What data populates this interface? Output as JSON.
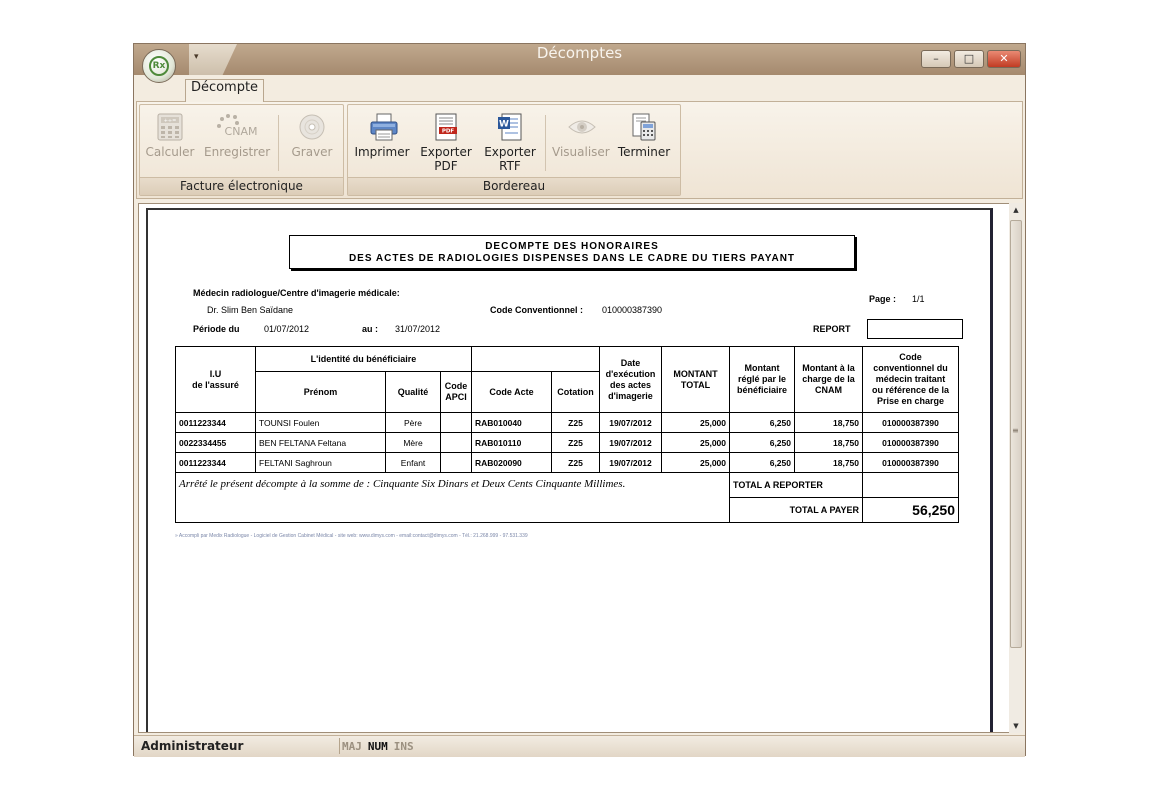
{
  "window": {
    "title": "Décomptes"
  },
  "app_button": {
    "label": "Rx"
  },
  "qat": {
    "arrow": "▾"
  },
  "controls": {
    "minimize": "–",
    "maximize": "□",
    "close": "✕"
  },
  "tabs": [
    {
      "label": "Décompte"
    }
  ],
  "ribbon": {
    "groups": [
      {
        "label": "Facture électronique"
      },
      {
        "label": "Bordereau"
      }
    ],
    "buttons": {
      "calculer": {
        "label": "Calculer",
        "icon": "calculator-icon",
        "icon_text": "+÷="
      },
      "enregistrer": {
        "label": "Enregistrer",
        "icon": "cnam-icon",
        "icon_text": "CNAM"
      },
      "graver": {
        "label": "Graver",
        "icon": "disc-icon"
      },
      "imprimer": {
        "label": "Imprimer",
        "icon": "printer-icon"
      },
      "exporter_pdf": {
        "line1": "Exporter",
        "line2": "PDF",
        "icon": "pdf-icon",
        "icon_text": "PDF"
      },
      "exporter_rtf": {
        "line1": "Exporter",
        "line2": "RTF",
        "icon": "word-icon",
        "icon_text": "W"
      },
      "visualiser": {
        "label": "Visualiser",
        "icon": "eye-icon"
      },
      "terminer": {
        "label": "Terminer",
        "icon": "calculator-document-icon"
      }
    }
  },
  "document": {
    "title_line1": "DECOMPTE DES HONORAIRES",
    "title_line2": "DES ACTES DE RADIOLOGIES DISPENSES DANS LE CADRE DU TIERS PAYANT",
    "medecin_label": "Médecin radiologue/Centre d'imagerie médicale:",
    "medecin_name": "Dr. Slim Ben Saïdane",
    "code_conv_label": "Code Conventionnel :",
    "code_conv_value": "010000387390",
    "page_label": "Page :",
    "page_value": "1/1",
    "periode_label": "Période du",
    "periode_from": "01/07/2012",
    "au_label": "au :",
    "periode_to": "31/07/2012",
    "report_label": "REPORT",
    "table": {
      "h_iu1": "I.U",
      "h_iu2": "de l'assuré",
      "h_identite": "L'identité du bénéficiaire",
      "h_prenom": "Prénom",
      "h_qualite": "Qualité",
      "h_code_apci1": "Code",
      "h_code_apci2": "APCI",
      "h_code_acte": "Code Acte",
      "h_cotation": "Cotation",
      "h_date1": "Date",
      "h_date2": "d'exécution",
      "h_date3": "des actes",
      "h_date4": "d'imagerie",
      "h_montant1": "MONTANT",
      "h_montant2": "TOTAL",
      "h_regle1": "Montant",
      "h_regle2": "réglé par le",
      "h_regle3": "bénéficiaire",
      "h_cnam1": "Montant à la",
      "h_cnam2": "charge de la",
      "h_cnam3": "CNAM",
      "h_code_med1": "Code",
      "h_code_med2": "conventionnel du",
      "h_code_med3": "médecin traitant",
      "h_code_med4": "ou référence de la",
      "h_code_med5": "Prise en charge",
      "rows": [
        {
          "iu": "0011223344",
          "prenom": "TOUNSI  Foulen",
          "qualite": "Père",
          "apci": "",
          "code_acte": "RAB010040",
          "cotation": "Z25",
          "date": "19/07/2012",
          "montant": "25,000",
          "regle": "6,250",
          "cnam": "18,750",
          "code_med": "010000387390"
        },
        {
          "iu": "0022334455",
          "prenom": "BEN FELTANA Feltana",
          "qualite": "Mère",
          "apci": "",
          "code_acte": "RAB010110",
          "cotation": "Z25",
          "date": "19/07/2012",
          "montant": "25,000",
          "regle": "6,250",
          "cnam": "18,750",
          "code_med": "010000387390"
        },
        {
          "iu": "0011223344",
          "prenom": "FELTANI Saghroun",
          "qualite": "Enfant",
          "apci": "",
          "code_acte": "RAB020090",
          "cotation": "Z25",
          "date": "19/07/2012",
          "montant": "25,000",
          "regle": "6,250",
          "cnam": "18,750",
          "code_med": "010000387390"
        }
      ],
      "arrete": "Arrêté le présent décompte à la somme de :  Cinquante Six Dinars et Deux Cents Cinquante Millimes.",
      "total_reporter_label": "TOTAL A REPORTER",
      "total_reporter_value": "",
      "total_payer_label": "TOTAL A PAYER",
      "total_payer_value": "56,250"
    },
    "footer": "» Accompli par Medix Radiologue - Logiciel de Gestion Cabinet Médical - site web: www.dimys.com - email:contact@dimys.com - Tél.: 21.268.999 - 97.531.339"
  },
  "statusbar": {
    "user": "Administrateur",
    "maj": "MAJ",
    "num": "NUM",
    "ins": "INS"
  },
  "colors": {
    "title_bar": "#a58a6e",
    "close_button": "#c13c24",
    "ribbon_bg": "#f3ece0",
    "app_logo": "#4e8a3a"
  }
}
